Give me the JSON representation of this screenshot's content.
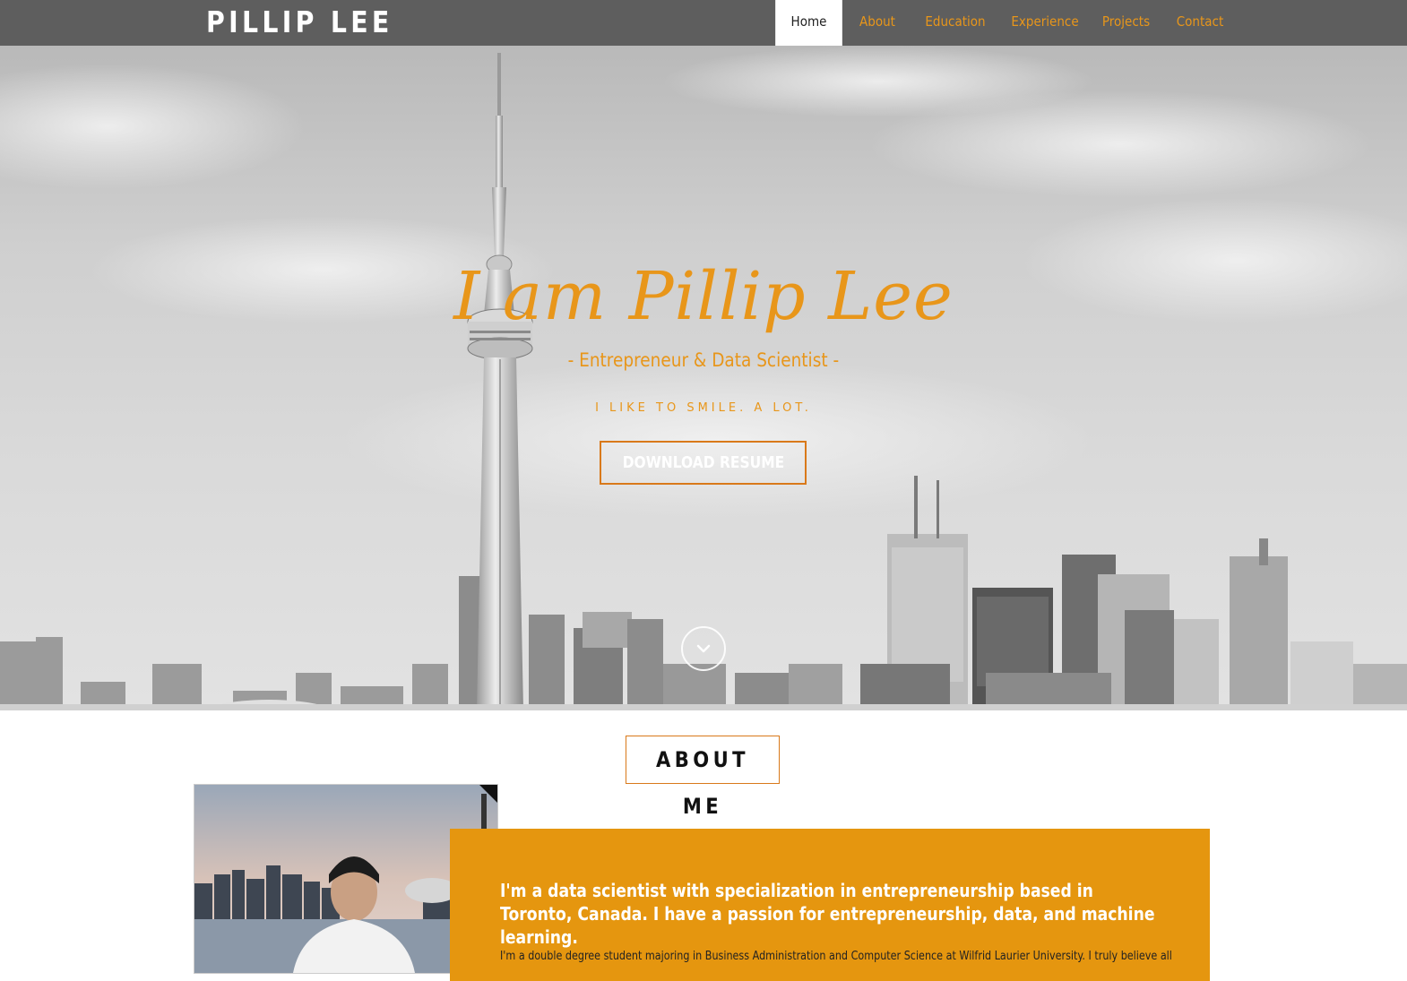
{
  "nav": {
    "brand": "PILLIP LEE",
    "items": [
      {
        "label": "Home",
        "active": true
      },
      {
        "label": "About",
        "active": false
      },
      {
        "label": "Education",
        "active": false
      },
      {
        "label": "Experience",
        "active": false
      },
      {
        "label": "Projects",
        "active": false
      },
      {
        "label": "Contact",
        "active": false
      }
    ]
  },
  "hero": {
    "title": "I am Pillip Lee",
    "subtitle": "- Entrepreneur & Data Scientist -",
    "tagline": "I LIKE TO SMILE. A LOT.",
    "button_label": "DOWNLOAD RESUME",
    "scroll_icon": "chevron-down-icon"
  },
  "about": {
    "heading": "ABOUT ME",
    "lead": "I'm a data scientist with specialization in entrepreneurship based in Toronto, Canada. I have a passion for entrepreneurship, data, and machine learning.",
    "body": "I'm a double degree student majoring in Business Administration and Computer Science at Wilfrid Laurier University. I truly believe all"
  },
  "colors": {
    "accent": "#e8961a",
    "nav_bg": "#5e5e5e",
    "card_bg": "#e5960f"
  }
}
